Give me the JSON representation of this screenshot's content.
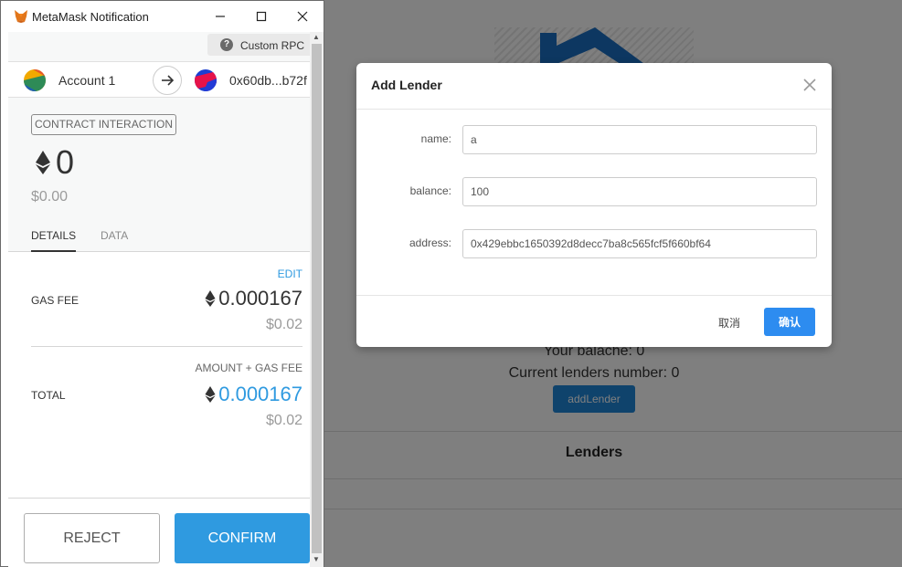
{
  "background_app": {
    "your_balance": "Your balache: 0",
    "lenders_number": "Current lenders number: 0",
    "add_lender_button": "addLender",
    "lenders_heading": "Lenders"
  },
  "modal": {
    "title": "Add Lender",
    "fields": [
      {
        "label": "name:",
        "value": "a"
      },
      {
        "label": "balance:",
        "value": "100"
      },
      {
        "label": "address:",
        "value": "0x429ebbc1650392d8decc7ba8c565fcf5f660bf64"
      }
    ],
    "cancel_label": "取消",
    "ok_label": "确认"
  },
  "metamask": {
    "window_title": "MetaMask Notification",
    "network": "Custom RPC",
    "from_account": "Account 1",
    "to_address": "0x60db...b72f",
    "badge": "CONTRACT INTERACTION",
    "eth_amount": "0",
    "usd_amount": "$0.00",
    "tabs": [
      "DETAILS",
      "DATA"
    ],
    "edit_label": "EDIT",
    "gas_fee_label": "GAS FEE",
    "gas_fee_eth": "0.000167",
    "gas_fee_usd": "$0.02",
    "amount_gas_label": "AMOUNT + GAS FEE",
    "total_label": "TOTAL",
    "total_eth": "0.000167",
    "total_usd": "$0.02",
    "reject_label": "REJECT",
    "confirm_label": "CONFIRM",
    "accent_color": "#2f9ae0"
  }
}
